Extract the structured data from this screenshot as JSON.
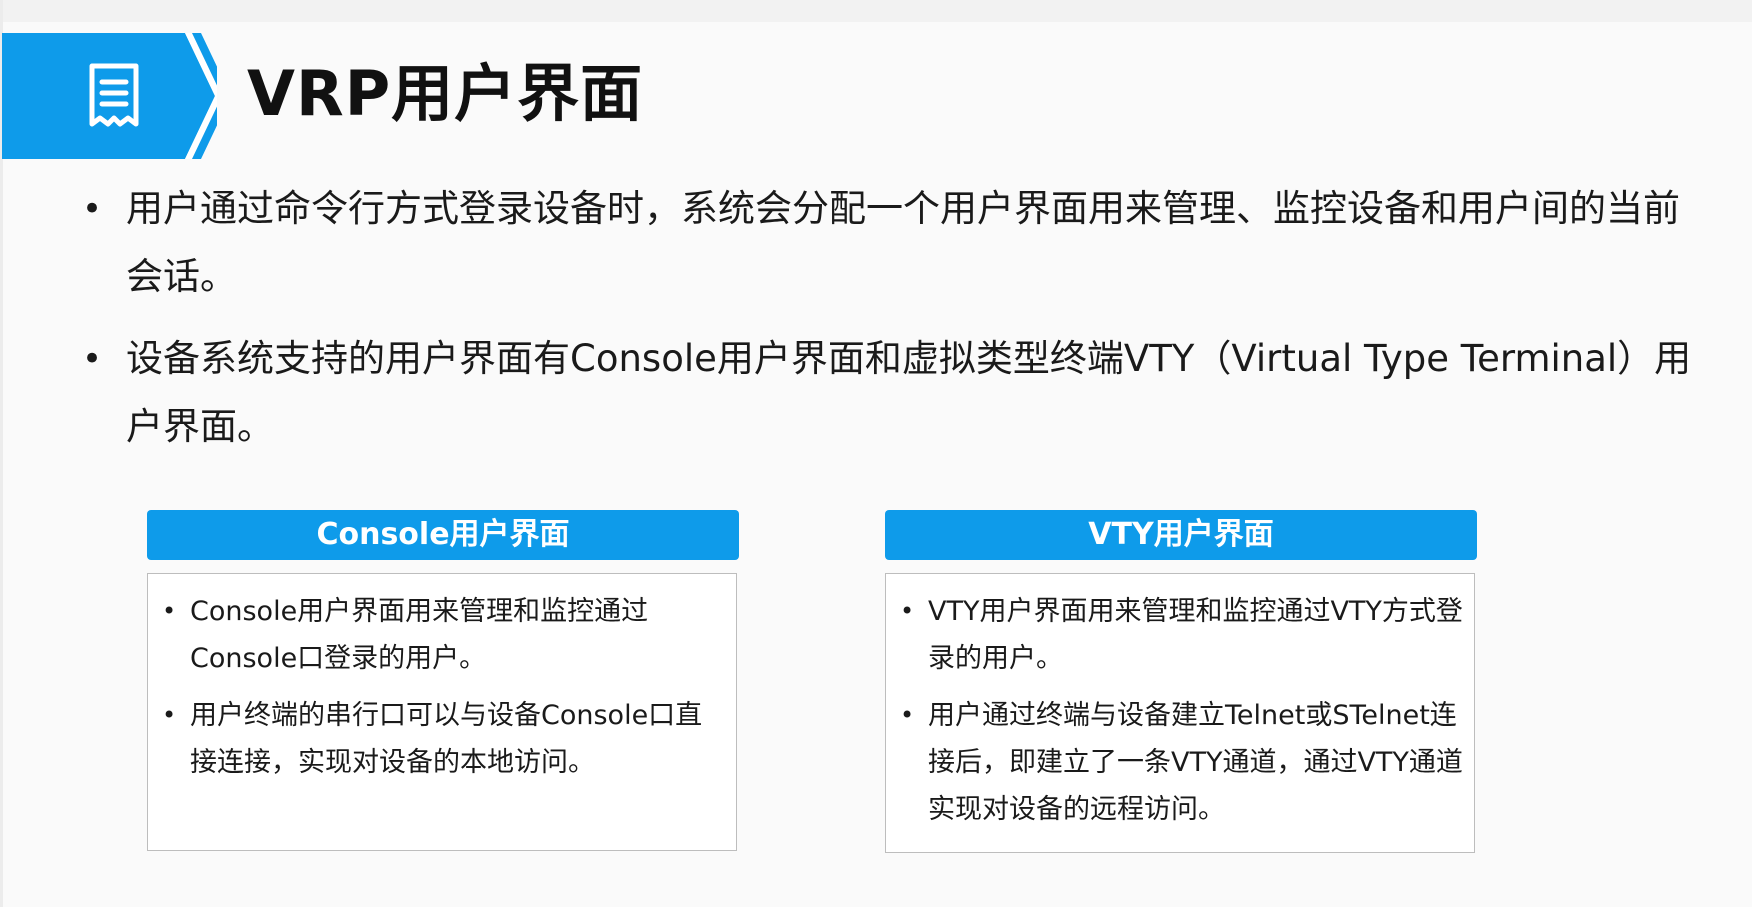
{
  "slide": {
    "title": "VRP用户界面",
    "icon": "document-icon",
    "accent_color": "#0e9bea"
  },
  "bullets": [
    {
      "text": "用户通过命令行方式登录设备时，系统会分配一个用户界面用来管理、监控设备和用户间的当前会话。"
    },
    {
      "text": "设备系统支持的用户界面有Console用户界面和虚拟类型终端VTY（Virtual Type Terminal）用户界面。"
    }
  ],
  "cards": [
    {
      "title": "Console用户界面",
      "items": [
        "Console用户界面用来管理和监控通过Console口登录的用户。",
        "用户终端的串行口可以与设备Console口直接连接，实现对设备的本地访问。"
      ]
    },
    {
      "title": "VTY用户界面",
      "items": [
        "VTY用户界面用来管理和监控通过VTY方式登录的用户。",
        "用户通过终端与设备建立Telnet或STelnet连接后，即建立了一条VTY通道，通过VTY通道实现对设备的远程访问。"
      ]
    }
  ]
}
